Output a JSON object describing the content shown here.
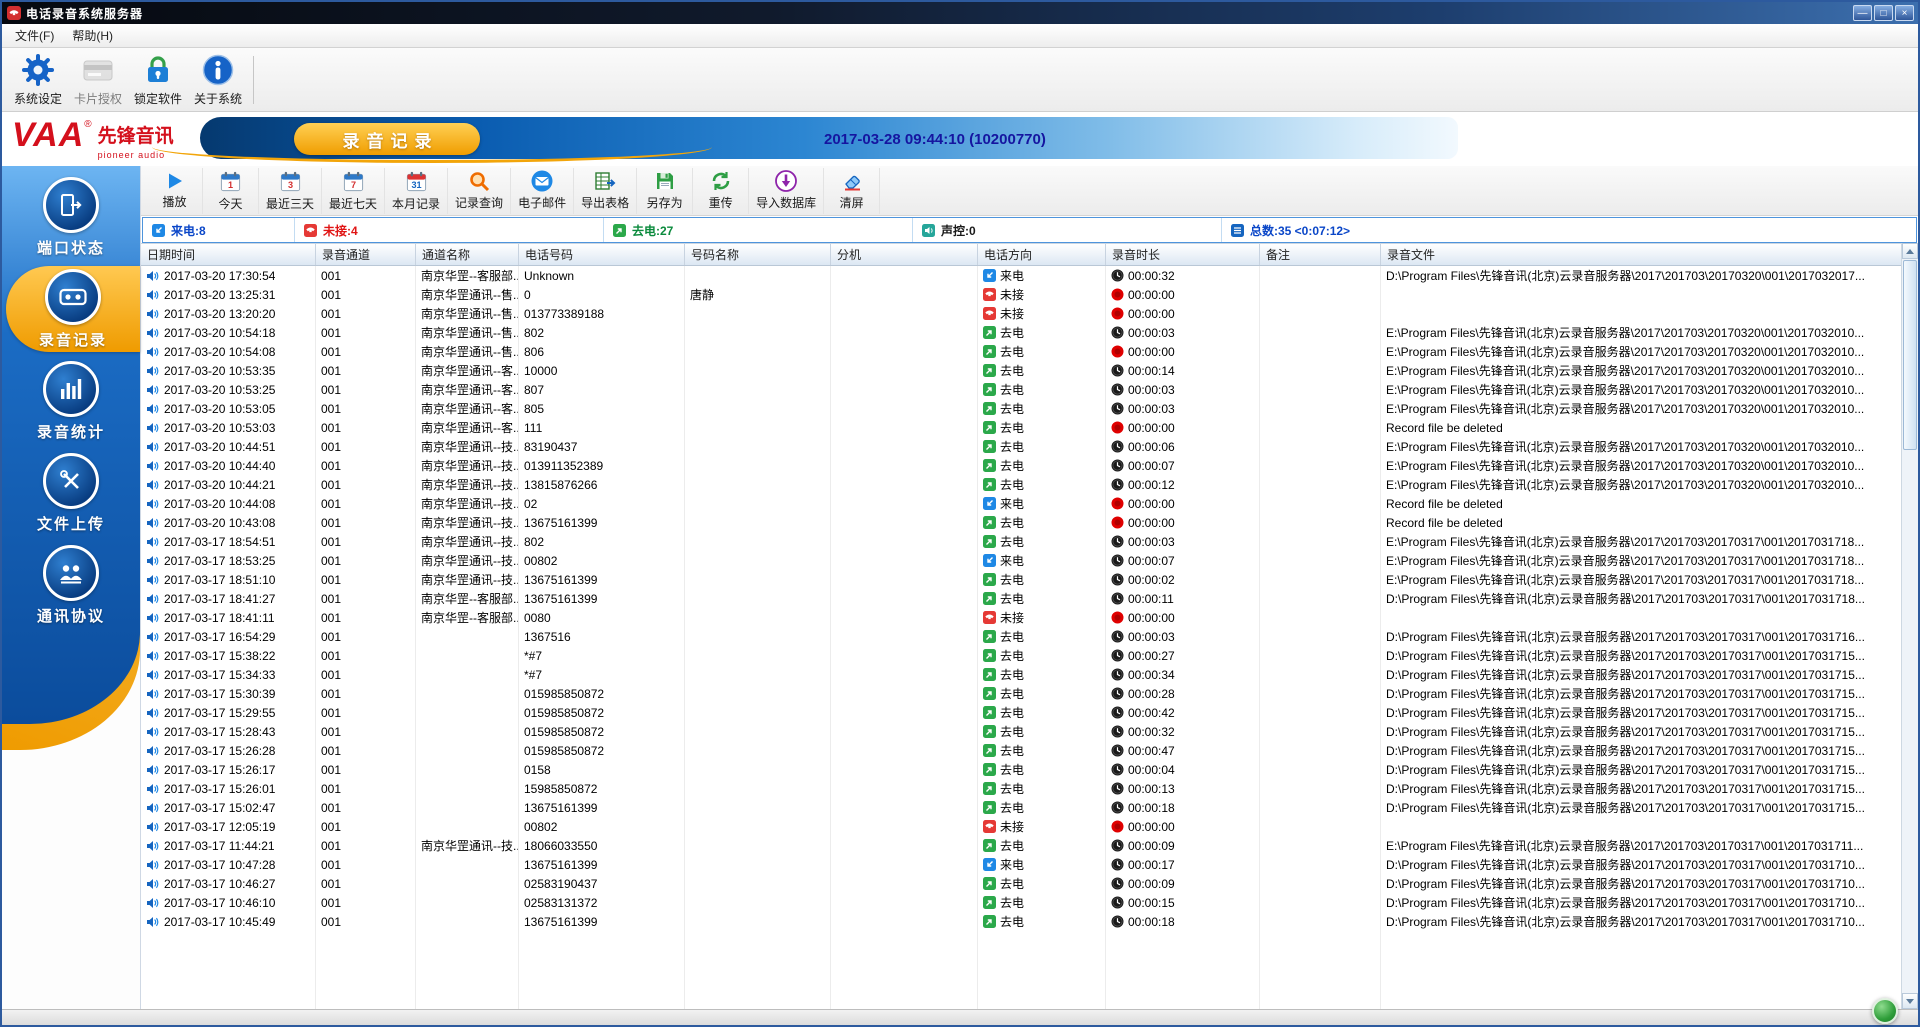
{
  "window": {
    "title": "电话录音系统服务器",
    "controls": {
      "minimize": "—",
      "maximize": "□",
      "close": "×"
    }
  },
  "menubar": {
    "items": [
      {
        "id": "file",
        "label": "文件(F)"
      },
      {
        "id": "help",
        "label": "帮助(H)"
      }
    ]
  },
  "main_toolbar": {
    "items": [
      {
        "id": "system-settings",
        "label": "系统设定",
        "icon": "gear-icon",
        "disabled": false
      },
      {
        "id": "card-authorization",
        "label": "卡片授权",
        "icon": "card-icon",
        "disabled": true
      },
      {
        "id": "lock-software",
        "label": "锁定软件",
        "icon": "lock-icon",
        "disabled": false
      },
      {
        "id": "about-system",
        "label": "关于系统",
        "icon": "info-icon",
        "disabled": false
      }
    ]
  },
  "banner": {
    "brand": "VAA",
    "brand_reg": "®",
    "brand_cn": "先锋音讯",
    "brand_en": "pioneer audio",
    "tab": "录音记录",
    "timestamp": "2017-03-28 09:44:10 (10200770)"
  },
  "sidebar": {
    "items": [
      {
        "id": "port-status",
        "label": "端口状态",
        "icon": "port-status-icon",
        "active": false
      },
      {
        "id": "recording-records",
        "label": "录音记录",
        "icon": "record-list-icon",
        "active": true
      },
      {
        "id": "recording-stats",
        "label": "录音统计",
        "icon": "record-stats-icon",
        "active": false
      },
      {
        "id": "file-upload",
        "label": "文件上传",
        "icon": "file-upload-icon",
        "active": false
      },
      {
        "id": "protocol",
        "label": "通讯协议",
        "icon": "protocol-icon",
        "active": false
      }
    ]
  },
  "actions": {
    "items": [
      {
        "id": "play",
        "label": "播放",
        "icon": "play-icon"
      },
      {
        "id": "today",
        "label": "今天",
        "icon": "calendar-today-icon"
      },
      {
        "id": "last-3-days",
        "label": "最近三天",
        "icon": "calendar-3days-icon"
      },
      {
        "id": "last-7-days",
        "label": "最近七天",
        "icon": "calendar-7days-icon"
      },
      {
        "id": "month-records",
        "label": "本月记录",
        "icon": "calendar-month-icon"
      },
      {
        "id": "record-query",
        "label": "记录查询",
        "icon": "search-icon"
      },
      {
        "id": "email",
        "label": "电子邮件",
        "icon": "email-icon"
      },
      {
        "id": "export-table",
        "label": "导出表格",
        "icon": "export-table-icon"
      },
      {
        "id": "save-as",
        "label": "另存为",
        "icon": "save-as-icon"
      },
      {
        "id": "retransmit",
        "label": "重传",
        "icon": "retransmit-icon"
      },
      {
        "id": "import-database",
        "label": "导入数据库",
        "icon": "import-db-icon"
      },
      {
        "id": "clear-screen",
        "label": "清屏",
        "icon": "clear-screen-icon"
      }
    ]
  },
  "stats": {
    "items": [
      {
        "id": "incoming",
        "label": "来电:8",
        "color": "#0a46c8",
        "icon": "incoming-call-icon"
      },
      {
        "id": "missed",
        "label": "未接:4",
        "color": "#e01414",
        "icon": "missed-call-icon"
      },
      {
        "id": "outgoing",
        "label": "去电:27",
        "color": "#0a8a3c",
        "icon": "outgoing-call-icon"
      },
      {
        "id": "voice-control",
        "label": "声控:0",
        "color": "#1a1a1a",
        "icon": "voice-control-icon"
      },
      {
        "id": "total",
        "label": "总数:35 <0:07:12>",
        "color": "#0a46c8",
        "icon": "total-count-icon"
      }
    ]
  },
  "direction_labels": {
    "in": "来电",
    "out": "去电",
    "missed": "未接"
  },
  "table": {
    "columns": [
      {
        "id": "datetime",
        "label": "日期时间"
      },
      {
        "id": "channel",
        "label": "录音通道"
      },
      {
        "id": "channel-name",
        "label": "通道名称"
      },
      {
        "id": "phone-number",
        "label": "电话号码"
      },
      {
        "id": "number-name",
        "label": "号码名称"
      },
      {
        "id": "extension",
        "label": "分机"
      },
      {
        "id": "direction",
        "label": "电话方向"
      },
      {
        "id": "duration",
        "label": "录音时长"
      },
      {
        "id": "note",
        "label": "备注"
      },
      {
        "id": "file",
        "label": "录音文件"
      }
    ],
    "rows": [
      {
        "time": "2017-03-20 17:30:54",
        "channel": "001",
        "cname": "南京华罡--客服部...",
        "phone": "Unknown",
        "pname": "",
        "ext": "",
        "dir": "in",
        "dur": "00:00:32",
        "zero": false,
        "note": "",
        "file": "D:\\Program Files\\先锋音讯(北京)云录音服务器\\2017\\201703\\20170320\\001\\2017032017..."
      },
      {
        "time": "2017-03-20 13:25:31",
        "channel": "001",
        "cname": "南京华罡通讯--售...",
        "phone": "0",
        "pname": "唐静",
        "ext": "",
        "dir": "missed",
        "dur": "00:00:00",
        "zero": true,
        "note": "",
        "file": ""
      },
      {
        "time": "2017-03-20 13:20:20",
        "channel": "001",
        "cname": "南京华罡通讯--售...",
        "phone": "013773389188",
        "pname": "",
        "ext": "",
        "dir": "missed",
        "dur": "00:00:00",
        "zero": true,
        "note": "",
        "file": ""
      },
      {
        "time": "2017-03-20 10:54:18",
        "channel": "001",
        "cname": "南京华罡通讯--售...",
        "phone": "802",
        "pname": "",
        "ext": "",
        "dir": "out",
        "dur": "00:00:03",
        "zero": false,
        "note": "",
        "file": "E:\\Program Files\\先锋音讯(北京)云录音服务器\\2017\\201703\\20170320\\001\\2017032010..."
      },
      {
        "time": "2017-03-20 10:54:08",
        "channel": "001",
        "cname": "南京华罡通讯--售...",
        "phone": "806",
        "pname": "",
        "ext": "",
        "dir": "out",
        "dur": "00:00:00",
        "zero": true,
        "note": "",
        "file": "E:\\Program Files\\先锋音讯(北京)云录音服务器\\2017\\201703\\20170320\\001\\2017032010..."
      },
      {
        "time": "2017-03-20 10:53:35",
        "channel": "001",
        "cname": "南京华罡通讯--客...",
        "phone": "10000",
        "pname": "",
        "ext": "",
        "dir": "out",
        "dur": "00:00:14",
        "zero": false,
        "note": "",
        "file": "E:\\Program Files\\先锋音讯(北京)云录音服务器\\2017\\201703\\20170320\\001\\2017032010..."
      },
      {
        "time": "2017-03-20 10:53:25",
        "channel": "001",
        "cname": "南京华罡通讯--客...",
        "phone": "807",
        "pname": "",
        "ext": "",
        "dir": "out",
        "dur": "00:00:03",
        "zero": false,
        "note": "",
        "file": "E:\\Program Files\\先锋音讯(北京)云录音服务器\\2017\\201703\\20170320\\001\\2017032010..."
      },
      {
        "time": "2017-03-20 10:53:05",
        "channel": "001",
        "cname": "南京华罡通讯--客...",
        "phone": "805",
        "pname": "",
        "ext": "",
        "dir": "out",
        "dur": "00:00:03",
        "zero": false,
        "note": "",
        "file": "E:\\Program Files\\先锋音讯(北京)云录音服务器\\2017\\201703\\20170320\\001\\2017032010..."
      },
      {
        "time": "2017-03-20 10:53:03",
        "channel": "001",
        "cname": "南京华罡通讯--客...",
        "phone": "111",
        "pname": "",
        "ext": "",
        "dir": "out",
        "dur": "00:00:00",
        "zero": true,
        "note": "",
        "file": "Record file be deleted"
      },
      {
        "time": "2017-03-20 10:44:51",
        "channel": "001",
        "cname": "南京华罡通讯--技...",
        "phone": "83190437",
        "pname": "",
        "ext": "",
        "dir": "out",
        "dur": "00:00:06",
        "zero": false,
        "note": "",
        "file": "E:\\Program Files\\先锋音讯(北京)云录音服务器\\2017\\201703\\20170320\\001\\2017032010..."
      },
      {
        "time": "2017-03-20 10:44:40",
        "channel": "001",
        "cname": "南京华罡通讯--技...",
        "phone": "013911352389",
        "pname": "",
        "ext": "",
        "dir": "out",
        "dur": "00:00:07",
        "zero": false,
        "note": "",
        "file": "E:\\Program Files\\先锋音讯(北京)云录音服务器\\2017\\201703\\20170320\\001\\2017032010..."
      },
      {
        "time": "2017-03-20 10:44:21",
        "channel": "001",
        "cname": "南京华罡通讯--技...",
        "phone": "13815876266",
        "pname": "",
        "ext": "",
        "dir": "out",
        "dur": "00:00:12",
        "zero": false,
        "note": "",
        "file": "E:\\Program Files\\先锋音讯(北京)云录音服务器\\2017\\201703\\20170320\\001\\2017032010..."
      },
      {
        "time": "2017-03-20 10:44:08",
        "channel": "001",
        "cname": "南京华罡通讯--技...",
        "phone": "02",
        "pname": "",
        "ext": "",
        "dir": "in",
        "dur": "00:00:00",
        "zero": true,
        "note": "",
        "file": "Record file be deleted"
      },
      {
        "time": "2017-03-20 10:43:08",
        "channel": "001",
        "cname": "南京华罡通讯--技...",
        "phone": "13675161399",
        "pname": "",
        "ext": "",
        "dir": "out",
        "dur": "00:00:00",
        "zero": true,
        "note": "",
        "file": "Record file be deleted"
      },
      {
        "time": "2017-03-17 18:54:51",
        "channel": "001",
        "cname": "南京华罡通讯--技...",
        "phone": "802",
        "pname": "",
        "ext": "",
        "dir": "out",
        "dur": "00:00:03",
        "zero": false,
        "note": "",
        "file": "E:\\Program Files\\先锋音讯(北京)云录音服务器\\2017\\201703\\20170317\\001\\2017031718..."
      },
      {
        "time": "2017-03-17 18:53:25",
        "channel": "001",
        "cname": "南京华罡通讯--技...",
        "phone": "00802",
        "pname": "",
        "ext": "",
        "dir": "in",
        "dur": "00:00:07",
        "zero": false,
        "note": "",
        "file": "E:\\Program Files\\先锋音讯(北京)云录音服务器\\2017\\201703\\20170317\\001\\2017031718..."
      },
      {
        "time": "2017-03-17 18:51:10",
        "channel": "001",
        "cname": "南京华罡通讯--技...",
        "phone": "13675161399",
        "pname": "",
        "ext": "",
        "dir": "out",
        "dur": "00:00:02",
        "zero": false,
        "note": "",
        "file": "E:\\Program Files\\先锋音讯(北京)云录音服务器\\2017\\201703\\20170317\\001\\2017031718..."
      },
      {
        "time": "2017-03-17 18:41:27",
        "channel": "001",
        "cname": "南京华罡--客服部...",
        "phone": "13675161399",
        "pname": "",
        "ext": "",
        "dir": "out",
        "dur": "00:00:11",
        "zero": false,
        "note": "",
        "file": "D:\\Program Files\\先锋音讯(北京)云录音服务器\\2017\\201703\\20170317\\001\\2017031718..."
      },
      {
        "time": "2017-03-17 18:41:11",
        "channel": "001",
        "cname": "南京华罡--客服部...",
        "phone": "0080",
        "pname": "",
        "ext": "",
        "dir": "missed",
        "dur": "00:00:00",
        "zero": true,
        "note": "",
        "file": ""
      },
      {
        "time": "2017-03-17 16:54:29",
        "channel": "001",
        "cname": "",
        "phone": "1367516",
        "pname": "",
        "ext": "",
        "dir": "out",
        "dur": "00:00:03",
        "zero": false,
        "note": "",
        "file": "D:\\Program Files\\先锋音讯(北京)云录音服务器\\2017\\201703\\20170317\\001\\2017031716..."
      },
      {
        "time": "2017-03-17 15:38:22",
        "channel": "001",
        "cname": "",
        "phone": "*#7",
        "pname": "",
        "ext": "",
        "dir": "out",
        "dur": "00:00:27",
        "zero": false,
        "note": "",
        "file": "D:\\Program Files\\先锋音讯(北京)云录音服务器\\2017\\201703\\20170317\\001\\2017031715..."
      },
      {
        "time": "2017-03-17 15:34:33",
        "channel": "001",
        "cname": "",
        "phone": "*#7",
        "pname": "",
        "ext": "",
        "dir": "out",
        "dur": "00:00:34",
        "zero": false,
        "note": "",
        "file": "D:\\Program Files\\先锋音讯(北京)云录音服务器\\2017\\201703\\20170317\\001\\2017031715..."
      },
      {
        "time": "2017-03-17 15:30:39",
        "channel": "001",
        "cname": "",
        "phone": "015985850872",
        "pname": "",
        "ext": "",
        "dir": "out",
        "dur": "00:00:28",
        "zero": false,
        "note": "",
        "file": "D:\\Program Files\\先锋音讯(北京)云录音服务器\\2017\\201703\\20170317\\001\\2017031715..."
      },
      {
        "time": "2017-03-17 15:29:55",
        "channel": "001",
        "cname": "",
        "phone": "015985850872",
        "pname": "",
        "ext": "",
        "dir": "out",
        "dur": "00:00:42",
        "zero": false,
        "note": "",
        "file": "D:\\Program Files\\先锋音讯(北京)云录音服务器\\2017\\201703\\20170317\\001\\2017031715..."
      },
      {
        "time": "2017-03-17 15:28:43",
        "channel": "001",
        "cname": "",
        "phone": "015985850872",
        "pname": "",
        "ext": "",
        "dir": "out",
        "dur": "00:00:32",
        "zero": false,
        "note": "",
        "file": "D:\\Program Files\\先锋音讯(北京)云录音服务器\\2017\\201703\\20170317\\001\\2017031715..."
      },
      {
        "time": "2017-03-17 15:26:28",
        "channel": "001",
        "cname": "",
        "phone": "015985850872",
        "pname": "",
        "ext": "",
        "dir": "out",
        "dur": "00:00:47",
        "zero": false,
        "note": "",
        "file": "D:\\Program Files\\先锋音讯(北京)云录音服务器\\2017\\201703\\20170317\\001\\2017031715..."
      },
      {
        "time": "2017-03-17 15:26:17",
        "channel": "001",
        "cname": "",
        "phone": "0158",
        "pname": "",
        "ext": "",
        "dir": "out",
        "dur": "00:00:04",
        "zero": false,
        "note": "",
        "file": "D:\\Program Files\\先锋音讯(北京)云录音服务器\\2017\\201703\\20170317\\001\\2017031715..."
      },
      {
        "time": "2017-03-17 15:26:01",
        "channel": "001",
        "cname": "",
        "phone": "15985850872",
        "pname": "",
        "ext": "",
        "dir": "out",
        "dur": "00:00:13",
        "zero": false,
        "note": "",
        "file": "D:\\Program Files\\先锋音讯(北京)云录音服务器\\2017\\201703\\20170317\\001\\2017031715..."
      },
      {
        "time": "2017-03-17 15:02:47",
        "channel": "001",
        "cname": "",
        "phone": "13675161399",
        "pname": "",
        "ext": "",
        "dir": "out",
        "dur": "00:00:18",
        "zero": false,
        "note": "",
        "file": "D:\\Program Files\\先锋音讯(北京)云录音服务器\\2017\\201703\\20170317\\001\\2017031715..."
      },
      {
        "time": "2017-03-17 12:05:19",
        "channel": "001",
        "cname": "",
        "phone": "00802",
        "pname": "",
        "ext": "",
        "dir": "missed",
        "dur": "00:00:00",
        "zero": true,
        "note": "",
        "file": ""
      },
      {
        "time": "2017-03-17 11:44:21",
        "channel": "001",
        "cname": "南京华罡通讯--技...",
        "phone": "18066033550",
        "pname": "",
        "ext": "",
        "dir": "out",
        "dur": "00:00:09",
        "zero": false,
        "note": "",
        "file": "E:\\Program Files\\先锋音讯(北京)云录音服务器\\2017\\201703\\20170317\\001\\2017031711..."
      },
      {
        "time": "2017-03-17 10:47:28",
        "channel": "001",
        "cname": "",
        "phone": "13675161399",
        "pname": "",
        "ext": "",
        "dir": "in",
        "dur": "00:00:17",
        "zero": false,
        "note": "",
        "file": "D:\\Program Files\\先锋音讯(北京)云录音服务器\\2017\\201703\\20170317\\001\\2017031710..."
      },
      {
        "time": "2017-03-17 10:46:27",
        "channel": "001",
        "cname": "",
        "phone": "02583190437",
        "pname": "",
        "ext": "",
        "dir": "out",
        "dur": "00:00:09",
        "zero": false,
        "note": "",
        "file": "D:\\Program Files\\先锋音讯(北京)云录音服务器\\2017\\201703\\20170317\\001\\2017031710..."
      },
      {
        "time": "2017-03-17 10:46:10",
        "channel": "001",
        "cname": "",
        "phone": "02583131372",
        "pname": "",
        "ext": "",
        "dir": "out",
        "dur": "00:00:15",
        "zero": false,
        "note": "",
        "file": "D:\\Program Files\\先锋音讯(北京)云录音服务器\\2017\\201703\\20170317\\001\\2017031710..."
      },
      {
        "time": "2017-03-17 10:45:49",
        "channel": "001",
        "cname": "",
        "phone": "13675161399",
        "pname": "",
        "ext": "",
        "dir": "out",
        "dur": "00:00:18",
        "zero": false,
        "note": "",
        "file": "D:\\Program Files\\先锋音讯(北京)云录音服务器\\2017\\201703\\20170317\\001\\2017031710..."
      }
    ]
  }
}
